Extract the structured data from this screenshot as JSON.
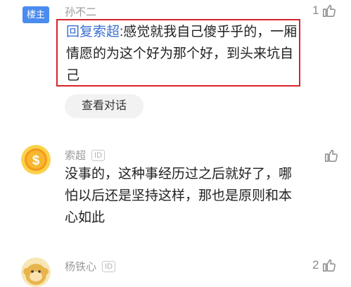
{
  "comment1": {
    "badge": "楼主",
    "username": "孙不二",
    "likes": "1",
    "reply": {
      "prefix": "回复",
      "mention": "索超",
      "text": ":感觉就我自己傻乎乎的，一厢情愿的为这个好为那个好，到头来坑自己"
    },
    "view_conversation": "查看对话"
  },
  "comment2": {
    "username": "索超",
    "id_badge": "ID",
    "likes": "",
    "text": "没事的，这种事经历过之后就好了，哪怕以后还是坚持这样，那也是原则和本心如此"
  },
  "comment3": {
    "username": "杨铁心",
    "id_badge": "ID",
    "likes": "2"
  },
  "colors": {
    "badge_blue": "#4a8bf0",
    "highlight_red": "#d8232a",
    "mention_blue": "#3b6fd0",
    "coin_orange": "#f39a1b"
  }
}
